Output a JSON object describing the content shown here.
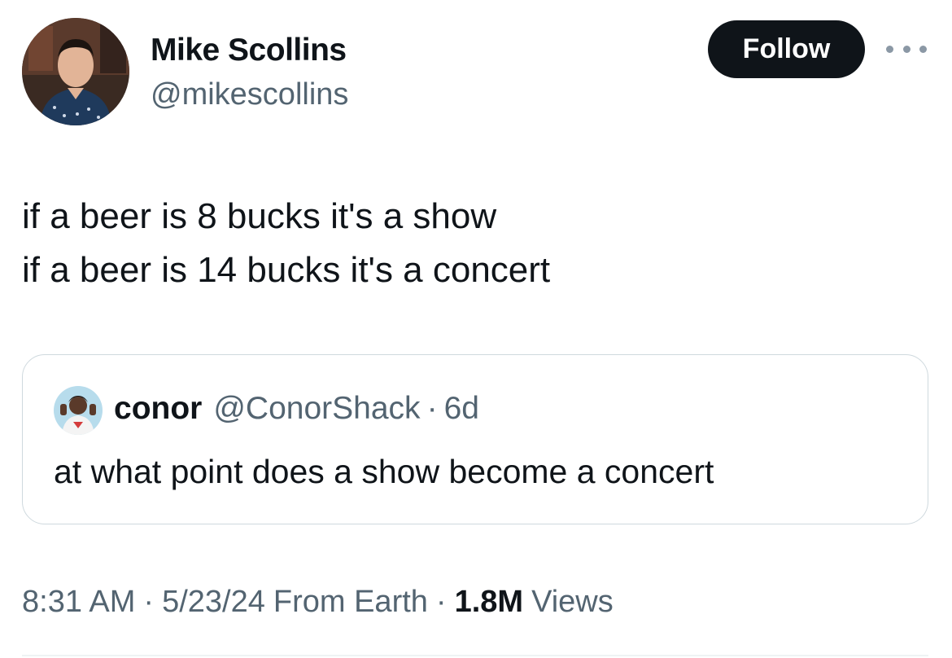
{
  "author": {
    "name": "Mike Scollins",
    "handle": "@mikescollins",
    "avatar": "profile-photo"
  },
  "follow_button": {
    "label": "Follow"
  },
  "more_menu": {
    "icon": "more-horizontal-icon"
  },
  "tweet": {
    "lines": [
      "if a beer is 8 bucks it's a show",
      "if a beer is 14 bucks it's a concert"
    ]
  },
  "quoted_tweet": {
    "name": "conor",
    "handle": "@ConorShack",
    "separator": "·",
    "time": "6d",
    "text": "at what point does a show become a concert",
    "avatar": "profile-photo"
  },
  "meta": {
    "time": "8:31 AM",
    "date": "5/23/24",
    "location": "From Earth",
    "separator": "·",
    "views_count": "1.8M",
    "views_label": "Views"
  },
  "colors": {
    "text": "#0f1419",
    "secondary": "#536471",
    "border": "#cfd9de",
    "button_bg": "#0f1419"
  }
}
